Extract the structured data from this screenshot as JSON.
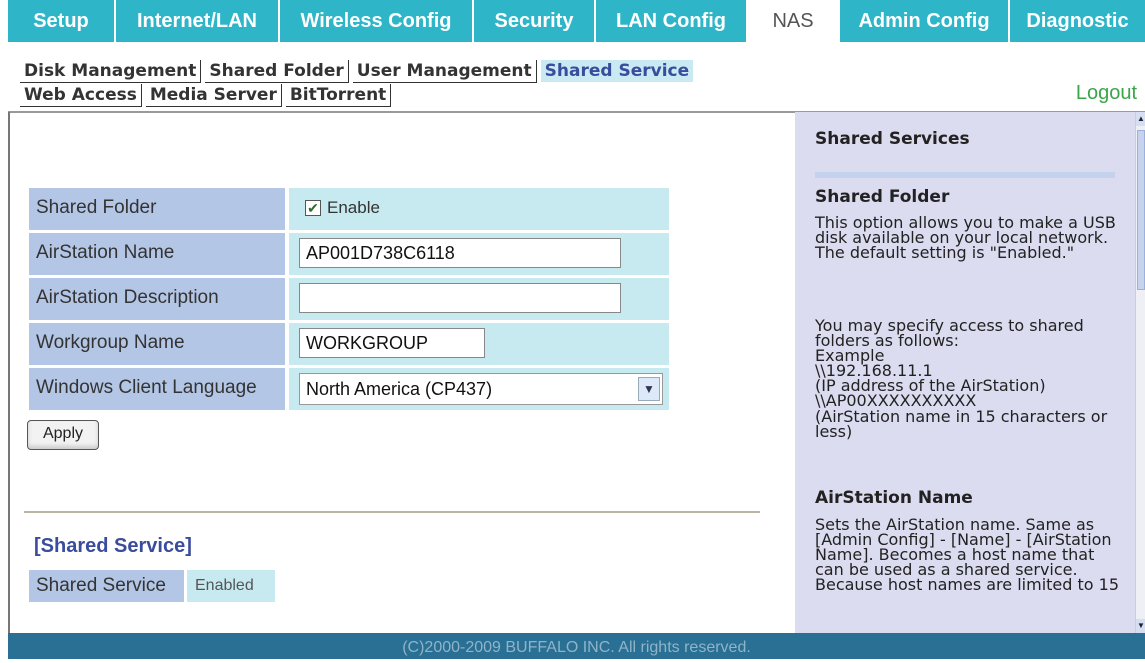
{
  "nav": {
    "tabs": [
      {
        "label": "Setup"
      },
      {
        "label": "Internet/LAN"
      },
      {
        "label": "Wireless Config"
      },
      {
        "label": "Security"
      },
      {
        "label": "LAN Config"
      },
      {
        "label": "NAS"
      },
      {
        "label": "Admin Config"
      },
      {
        "label": "Diagnostic"
      }
    ],
    "active": "NAS"
  },
  "subnav": {
    "row1": [
      "Disk Management",
      "Shared Folder",
      "User Management",
      "Shared Service"
    ],
    "row2": [
      "Web Access",
      "Media Server",
      "BitTorrent"
    ],
    "active": "Shared Service"
  },
  "logout": "Logout",
  "form": {
    "shared_folder": {
      "label": "Shared Folder",
      "checkbox_label": "Enable",
      "checked": true
    },
    "airstation_name": {
      "label": "AirStation Name",
      "value": "AP001D738C6118"
    },
    "airstation_description": {
      "label": "AirStation Description",
      "value": ""
    },
    "workgroup_name": {
      "label": "Workgroup Name",
      "value": "WORKGROUP"
    },
    "windows_client_language": {
      "label": "Windows Client Language",
      "value": "North America (CP437)"
    },
    "apply_label": "Apply"
  },
  "shared_service": {
    "title": "[Shared Service]",
    "label": "Shared Service",
    "value": "Enabled"
  },
  "help": {
    "title": "Shared Services",
    "shared_folder_heading": "Shared Folder",
    "shared_folder_p1": "This option allows you to make a USB disk available on your local network. The default setting is \"Enabled.\"",
    "shared_folder_p2": "You may specify access to shared folders as follows:",
    "example_label": "Example",
    "example_ip": "\\\\192.168.11.1",
    "example_ip_note": "(IP address of the AirStation)",
    "example_name": "\\\\AP00XXXXXXXXXX",
    "example_name_note": "(AirStation name in 15 characters or less)",
    "airstation_name_heading": "AirStation Name",
    "airstation_name_p": "Sets the AirStation name. Same as [Admin Config] - [Name] - [AirStation Name]. Becomes a host name that can be used as a shared service. Because host names are limited to 15"
  },
  "footer": "(C)2000-2009 BUFFALO INC. All rights reserved.",
  "colors": {
    "nav_bg": "#2fb5c8",
    "label_bg": "#b4c6e6",
    "value_bg": "#c6eaf0",
    "help_bg": "#dbdcf0",
    "footer_bg": "#2a6f94",
    "accent_blue": "#3a4c9c",
    "logout_green": "#3aa64a"
  }
}
